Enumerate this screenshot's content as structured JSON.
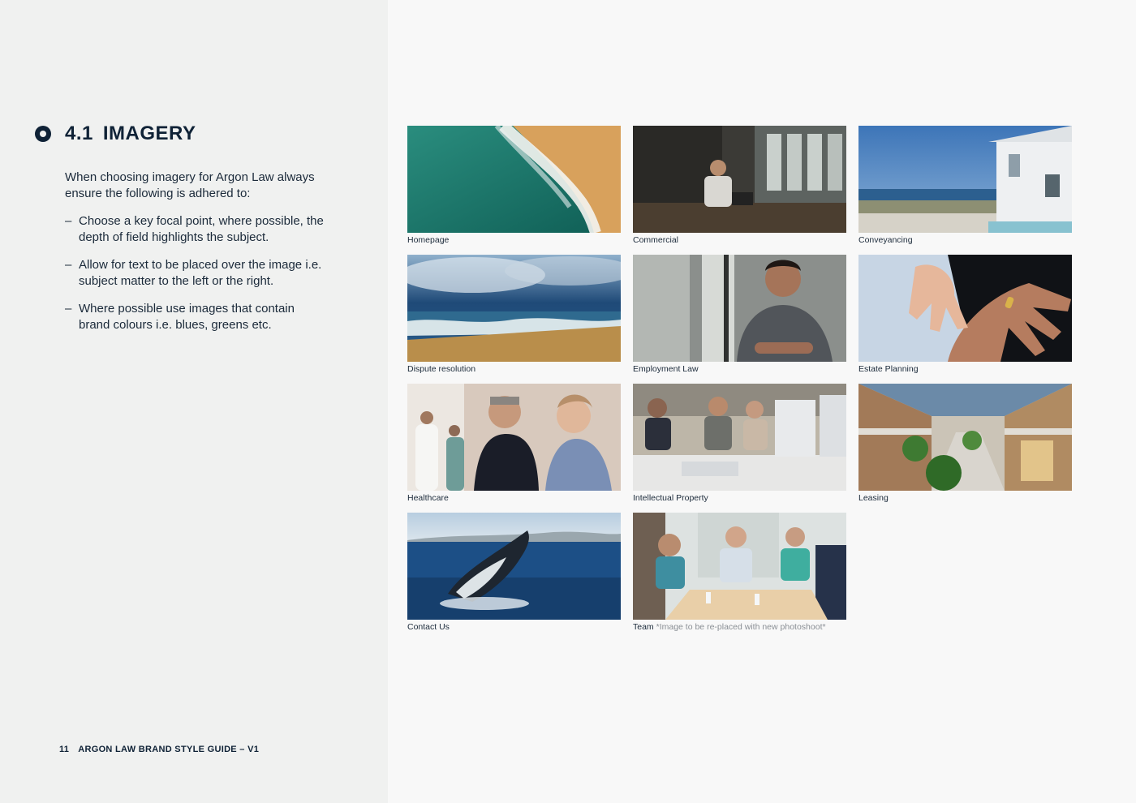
{
  "section": {
    "number": "4.1",
    "title": "IMAGERY",
    "intro": "When choosing imagery for Argon Law always ensure the following is adhered to:",
    "guidelines": [
      "Choose a key focal point, where possible, the depth of field highlights the subject.",
      "Allow for text to be placed over the image i.e. subject matter to the left or the right.",
      "Where possible use images that contain brand colours i.e. blues, greens etc."
    ],
    "dash": "–"
  },
  "footer": {
    "page_number": "11",
    "label": "ARGON LAW BRAND STYLE GUIDE – V1"
  },
  "gallery": [
    {
      "caption": "Homepage",
      "subject": "aerial beach waves",
      "note": ""
    },
    {
      "caption": "Commercial",
      "subject": "man on phone at cafe laptop",
      "note": ""
    },
    {
      "caption": "Conveyancing",
      "subject": "white beach house with sea view",
      "note": ""
    },
    {
      "caption": "Dispute resolution",
      "subject": "stormy sky over beach",
      "note": ""
    },
    {
      "caption": "Employment Law",
      "subject": "smiling man arms crossed in office",
      "note": ""
    },
    {
      "caption": "Estate Planning",
      "subject": "child hand on elderly hand",
      "note": ""
    },
    {
      "caption": "Healthcare",
      "subject": "doctor talking with nurse",
      "note": ""
    },
    {
      "caption": "Intellectual Property",
      "subject": "team working at computers",
      "note": ""
    },
    {
      "caption": "Leasing",
      "subject": "shopping mall interior",
      "note": ""
    },
    {
      "caption": "Contact Us",
      "subject": "humpback whale breaching",
      "note": ""
    },
    {
      "caption": "Team",
      "subject": "team meeting around table",
      "note": "*Image to be re-placed with new photoshoot*"
    }
  ],
  "colors": {
    "navy": "#0f2236",
    "left_panel": "#f0f1f0",
    "right_panel": "#f8f8f8",
    "note_grey": "#8a8f95"
  }
}
